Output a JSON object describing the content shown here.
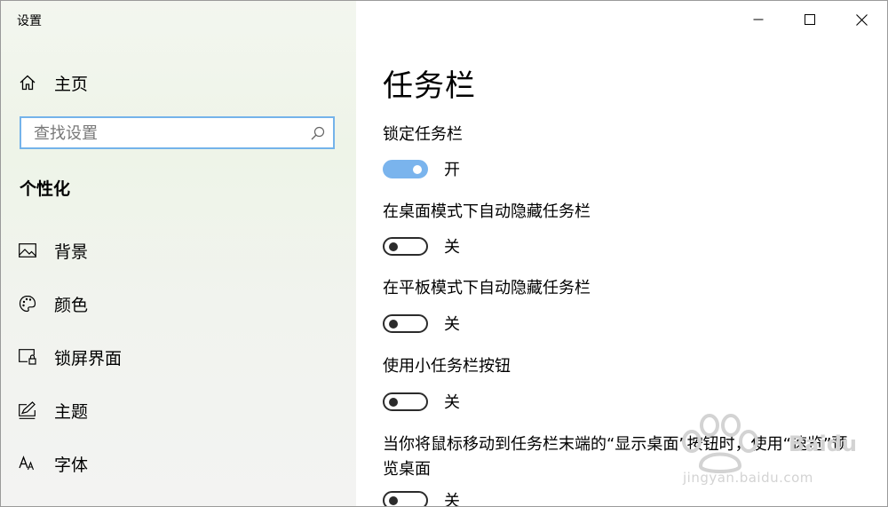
{
  "window": {
    "title": "设置"
  },
  "sidebar": {
    "home_label": "主页",
    "search_placeholder": "查找设置",
    "section_label": "个性化",
    "items": [
      {
        "label": "背景",
        "icon": "picture-icon"
      },
      {
        "label": "颜色",
        "icon": "palette-icon"
      },
      {
        "label": "锁屏界面",
        "icon": "lock-screen-icon"
      },
      {
        "label": "主题",
        "icon": "theme-icon"
      },
      {
        "label": "字体",
        "icon": "font-icon"
      }
    ]
  },
  "main": {
    "title": "任务栏",
    "settings": [
      {
        "label": "锁定任务栏",
        "state": "开",
        "on": true
      },
      {
        "label": "在桌面模式下自动隐藏任务栏",
        "state": "关",
        "on": false
      },
      {
        "label": "在平板模式下自动隐藏任务栏",
        "state": "关",
        "on": false
      },
      {
        "label": "使用小任务栏按钮",
        "state": "关",
        "on": false
      },
      {
        "label": "当你将鼠标移动到任务栏末端的“显示桌面”按钮时，使用“速览”预览桌面",
        "state": "关",
        "on": false
      }
    ]
  },
  "watermark": {
    "text": "Baidu",
    "url": "jingyan.baidu.com"
  },
  "colors": {
    "accent": "#7ab4ed",
    "search_border": "#74b3ea",
    "sidebar_bg": "#f2f5ee"
  }
}
